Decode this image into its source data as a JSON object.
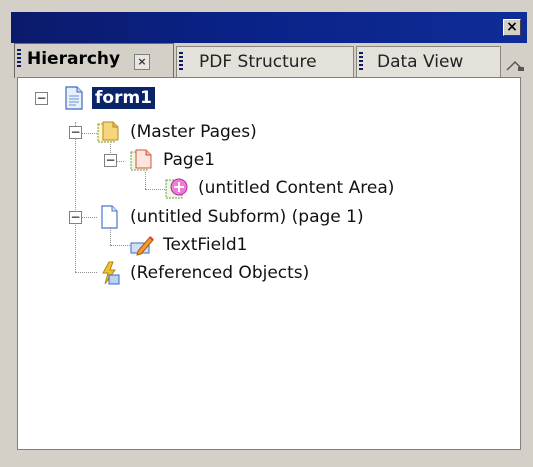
{
  "window": {
    "close_glyph": "×"
  },
  "tabs": [
    {
      "label": "Hierarchy",
      "active": true,
      "close_glyph": "×"
    },
    {
      "label": "PDF Structure",
      "active": false
    },
    {
      "label": "Data View",
      "active": false
    }
  ],
  "tree": {
    "root": {
      "label": "form1",
      "icon": "document-icon",
      "expanded": true
    },
    "master_pages": {
      "label": "(Master Pages)",
      "icon": "master-pages-icon",
      "expanded": true
    },
    "page1": {
      "label": "Page1",
      "icon": "page-icon",
      "expanded": true
    },
    "content_area": {
      "label": "(untitled Content Area)",
      "icon": "content-area-icon"
    },
    "subform": {
      "label": "(untitled Subform) (page 1)",
      "icon": "subform-icon",
      "expanded": true
    },
    "textfield": {
      "label": "TextField1",
      "icon": "text-field-icon"
    },
    "referenced": {
      "label": "(Referenced Objects)",
      "icon": "referenced-objects-icon"
    }
  },
  "colors": {
    "selection": "#0a246a",
    "titlebar": "#0a2288"
  }
}
